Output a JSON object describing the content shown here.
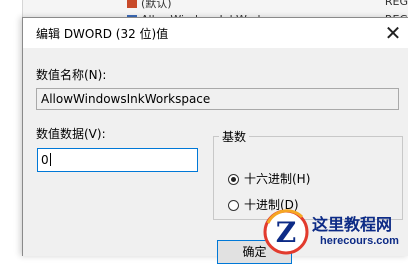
{
  "background_window": {
    "row1_text": "(默认)",
    "row1_right": "REG",
    "row2_text": "AllowWindowsInkWorkspace",
    "row2_right": "REG"
  },
  "dialog": {
    "title": "编辑 DWORD (32 位)值",
    "close_glyph": "✕",
    "value_name_label": "数值名称(N):",
    "value_name": "AllowWindowsInkWorkspace",
    "value_data_label": "数值数据(V):",
    "value_data": "0",
    "base_group_label": "基数",
    "base_options": [
      {
        "label": "十六进制(H)",
        "checked": true
      },
      {
        "label": "十进制(D)",
        "checked": false
      }
    ],
    "ok_label": "确定"
  },
  "watermark": {
    "logo_letter": "Z",
    "site_name": "这里教程网",
    "site_url": "herecours.com"
  }
}
